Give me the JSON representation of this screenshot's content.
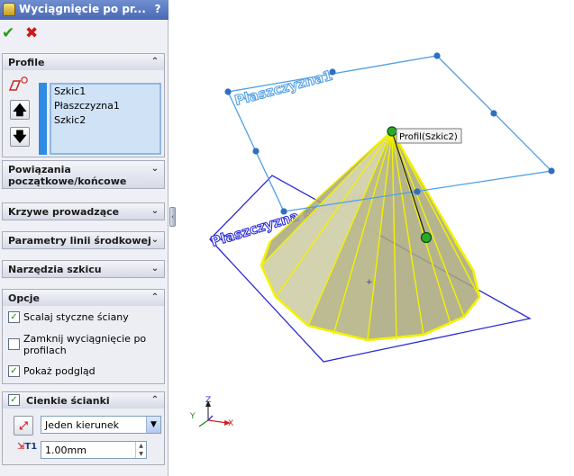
{
  "window": {
    "title": "Wyciągnięcie po pr...",
    "help": "?"
  },
  "actions": {
    "ok": "✔",
    "cancel": "✖"
  },
  "sections": {
    "profile": {
      "title": "Profile",
      "items": [
        "Szkic1",
        "Płaszczyzna1",
        "Szkic2"
      ],
      "up": "🡅",
      "down": "🡇"
    },
    "start_end": {
      "title": "Powiązania początkowe/końcowe"
    },
    "guides": {
      "title": "Krzywe prowadzące"
    },
    "centerline": {
      "title": "Parametry linii środkowej"
    },
    "sketch_tools": {
      "title": "Narzędzia szkicu"
    },
    "options": {
      "title": "Opcje",
      "merge_tangent": {
        "label": "Scalaj styczne ściany",
        "checked": true
      },
      "close_loft": {
        "label": "Zamknij wyciągnięcie po profilach",
        "checked": false
      },
      "show_preview": {
        "label": "Pokaż podgląd",
        "checked": true
      }
    },
    "thin": {
      "title": "Cienkie ścianki",
      "checked": true,
      "direction": "Jeden kierunek",
      "thickness": "1.00mm",
      "thickness_symbol": "T1"
    }
  },
  "viewport": {
    "plane_top_label": "Płaszczyzna1",
    "plane_front_label": "Płaszczyzna przednia",
    "callout": "Profil(Szkic2)",
    "triad": {
      "x": "X",
      "y": "Y",
      "z": "Z"
    },
    "colors": {
      "plane": "#4f9fe6",
      "front_plane": "#2b2bd6",
      "highlight": "#f2f200",
      "surface": "#a9a77a"
    }
  }
}
